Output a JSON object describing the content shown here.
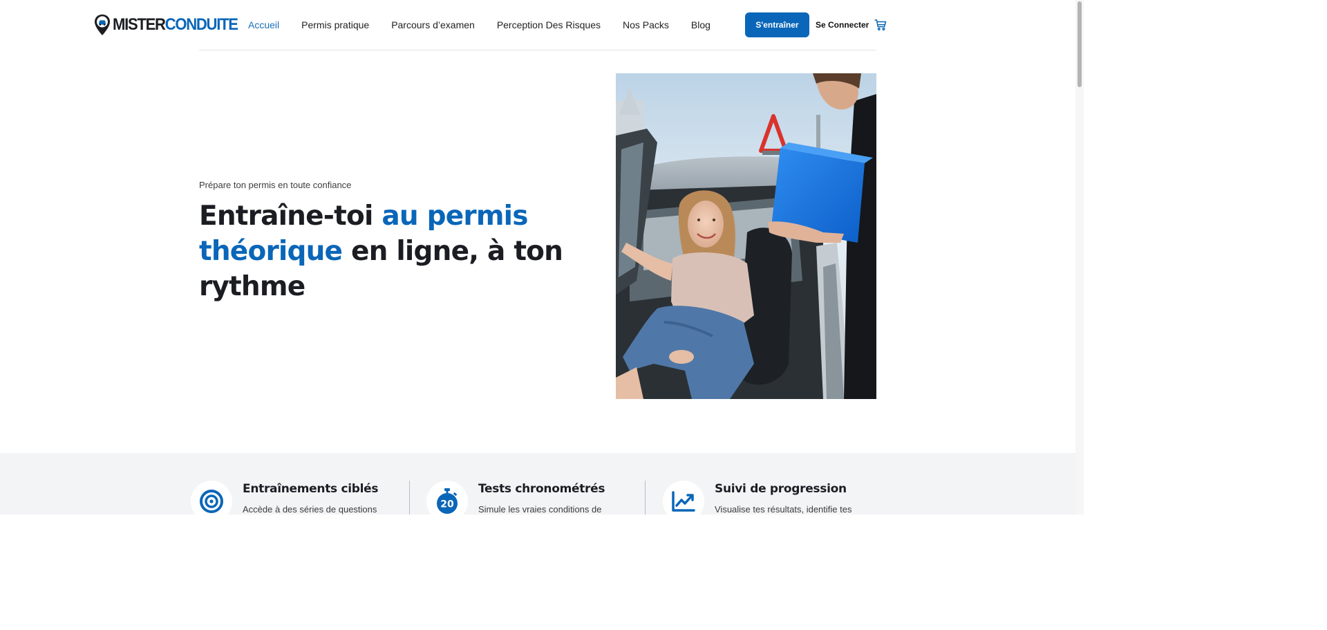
{
  "header": {
    "logo": {
      "part1": "MISTER",
      "part2": "CONDUITE"
    },
    "nav": [
      {
        "label": "Accueil",
        "active": true
      },
      {
        "label": "Permis pratique",
        "active": false
      },
      {
        "label": "Parcours d’examen",
        "active": false
      },
      {
        "label": "Perception Des Risques",
        "active": false
      },
      {
        "label": "Nos Packs",
        "active": false
      },
      {
        "label": "Blog",
        "active": false
      }
    ],
    "cta_label": "S'entraîner",
    "login_label": "Se Connecter",
    "cart_icon": "cart-icon"
  },
  "hero": {
    "kicker": "Prépare ton permis en toute confiance",
    "headline": {
      "part1": "Entraîne-toi ",
      "highlight": "au permis théorique",
      "part2": " en ligne, à ton rythme"
    }
  },
  "features": [
    {
      "icon": "target-icon",
      "title": "Entraînements ciblés",
      "desc": "Accède à des séries de questions"
    },
    {
      "icon": "stopwatch-icon",
      "title": "Tests chronométrés",
      "desc": "Simule les vraies conditions de",
      "icon_text": "20"
    },
    {
      "icon": "chart-up-icon",
      "title": "Suivi de progression",
      "desc": "Visualise tes résultats, identifie tes"
    }
  ],
  "colors": {
    "brand": "#0a66b8",
    "text": "#1c1d22",
    "band": "#f3f4f6"
  }
}
